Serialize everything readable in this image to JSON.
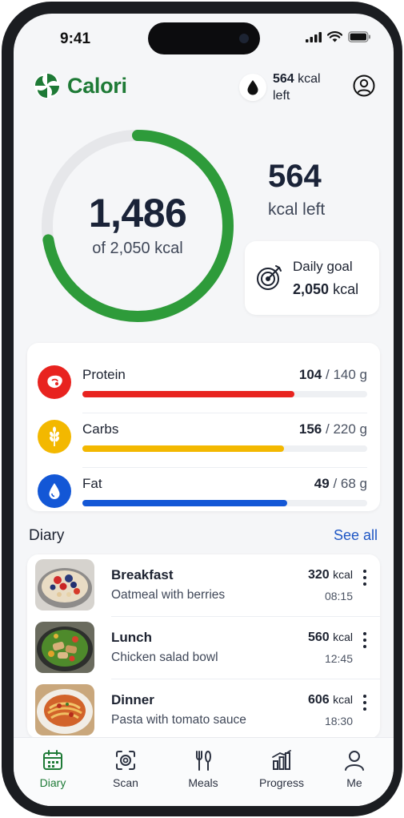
{
  "status_bar": {
    "time": "9:41"
  },
  "header": {
    "app_name": "Calori",
    "kcal_chip_value": "564",
    "kcal_chip_unit": "kcal",
    "kcal_chip_suffix": "left"
  },
  "summary": {
    "consumed": "1,486",
    "of_goal": "of 2,050 kcal",
    "progress_fraction": 0.725,
    "left_value": "564",
    "left_label": "kcal left",
    "goal_label": "Daily goal",
    "goal_value": "2,050",
    "goal_unit": "kcal"
  },
  "macros": [
    {
      "name": "Protein",
      "value": "104",
      "target": "/ 140 g",
      "fraction": 0.743,
      "color": "#e8231f",
      "icon": "steak-icon"
    },
    {
      "name": "Carbs",
      "value": "156",
      "target": "/ 220 g",
      "fraction": 0.709,
      "color": "#f3b800",
      "icon": "wheat-icon"
    },
    {
      "name": "Fat",
      "value": "49",
      "target": "/ 68 g",
      "fraction": 0.72,
      "color": "#1357d6",
      "icon": "drop-icon"
    }
  ],
  "diary": {
    "title": "Diary",
    "see_all": "See all",
    "entries": [
      {
        "meal": "Breakfast",
        "desc": "Oatmeal with berries",
        "kcal": "320",
        "unit": "kcal",
        "time": "08:15"
      },
      {
        "meal": "Lunch",
        "desc": "Chicken salad bowl",
        "kcal": "560",
        "unit": "kcal",
        "time": "12:45"
      },
      {
        "meal": "Dinner",
        "desc": "Pasta with tomato sauce",
        "kcal": "606",
        "unit": "kcal",
        "time": "18:30"
      }
    ]
  },
  "tabs": [
    {
      "label": "Diary",
      "icon": "calendar-icon",
      "active": true
    },
    {
      "label": "Scan",
      "icon": "scan-icon",
      "active": false
    },
    {
      "label": "Meals",
      "icon": "utensils-icon",
      "active": false
    },
    {
      "label": "Progress",
      "icon": "chart-icon",
      "active": false
    },
    {
      "label": "Me",
      "icon": "user-icon",
      "active": false
    }
  ],
  "colors": {
    "brand": "#1e7a36",
    "ring": "#2e9b3a",
    "ring_track": "#e6e7ea",
    "link": "#1e56c4"
  }
}
